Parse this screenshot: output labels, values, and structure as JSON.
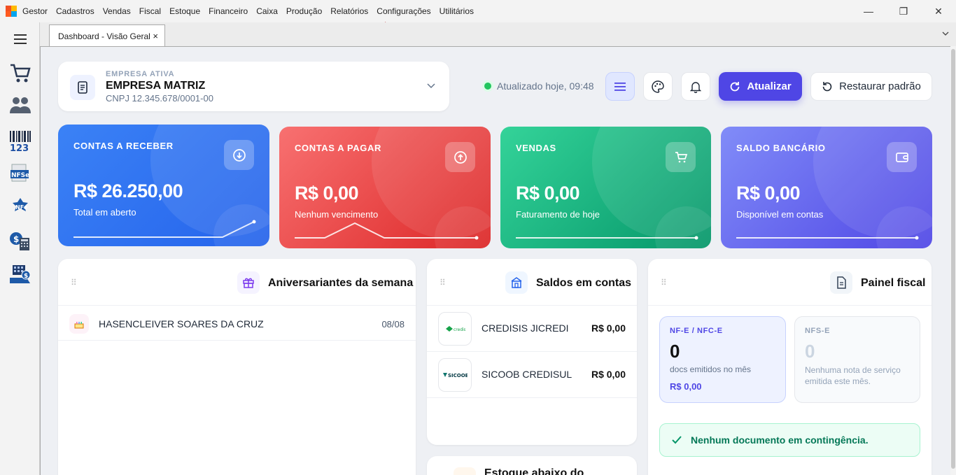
{
  "app": {
    "name": "Gestor"
  },
  "menu": [
    "Cadastros",
    "Vendas",
    "Fiscal",
    "Estoque",
    "Financeiro",
    "Caixa",
    "Produção",
    "Relatórios",
    "Configurações",
    "Utilitários"
  ],
  "window": {
    "minimize": "—",
    "restore": "❐",
    "close": "✕"
  },
  "tabs": [
    {
      "label": "Dashboard - Visão Geral",
      "close": "×"
    }
  ],
  "company": {
    "caption": "EMPRESA ATIVA",
    "name": "EMPRESA MATRIZ",
    "cnpj": "CNPJ 12.345.678/0001-00"
  },
  "header": {
    "updated": "Atualizado hoje, 09:48",
    "refresh_label": "Atualizar",
    "restore_label": "Restaurar padrão"
  },
  "stats": [
    {
      "title": "CONTAS A RECEBER",
      "value": "R$ 26.250,00",
      "sub": "Total em aberto",
      "color_from": "#3b82f6",
      "color_to": "#2563eb"
    },
    {
      "title": "CONTAS A PAGAR",
      "value": "R$ 0,00",
      "sub": "Nenhum vencimento",
      "color_from": "#f87171",
      "color_to": "#dc2626"
    },
    {
      "title": "VENDAS",
      "value": "R$ 0,00",
      "sub": "Faturamento de hoje",
      "color_from": "#34d399",
      "color_to": "#059669"
    },
    {
      "title": "SALDO BANCÁRIO",
      "value": "R$ 0,00",
      "sub": "Disponível em contas",
      "color_from": "#818cf8",
      "color_to": "#4f46e5"
    }
  ],
  "birthdays": {
    "title": "Aniversariantes da semana",
    "items": [
      {
        "name": "HASENCLEIVER SOARES DA CRUZ",
        "date": "08/08"
      }
    ]
  },
  "balances": {
    "title": "Saldos em contas",
    "items": [
      {
        "bank": "CREDISIS JICREDI",
        "value": "R$ 0,00",
        "logo": "credisis"
      },
      {
        "bank": "SICOOB CREDISUL",
        "value": "R$ 0,00",
        "logo": "SICOOB"
      }
    ]
  },
  "fiscal": {
    "title": "Painel fiscal",
    "nfe": {
      "label": "NF-E / NFC-E",
      "count": "0",
      "desc": "docs emitidos no mês",
      "value": "R$ 0,00"
    },
    "nfse": {
      "label": "NFS-E",
      "count": "0",
      "desc": "Nenhuma nota de serviço emitida este mês."
    },
    "contingency": "Nenhum documento em contingência."
  },
  "next_card": {
    "title": "Estoque abaixo do"
  }
}
